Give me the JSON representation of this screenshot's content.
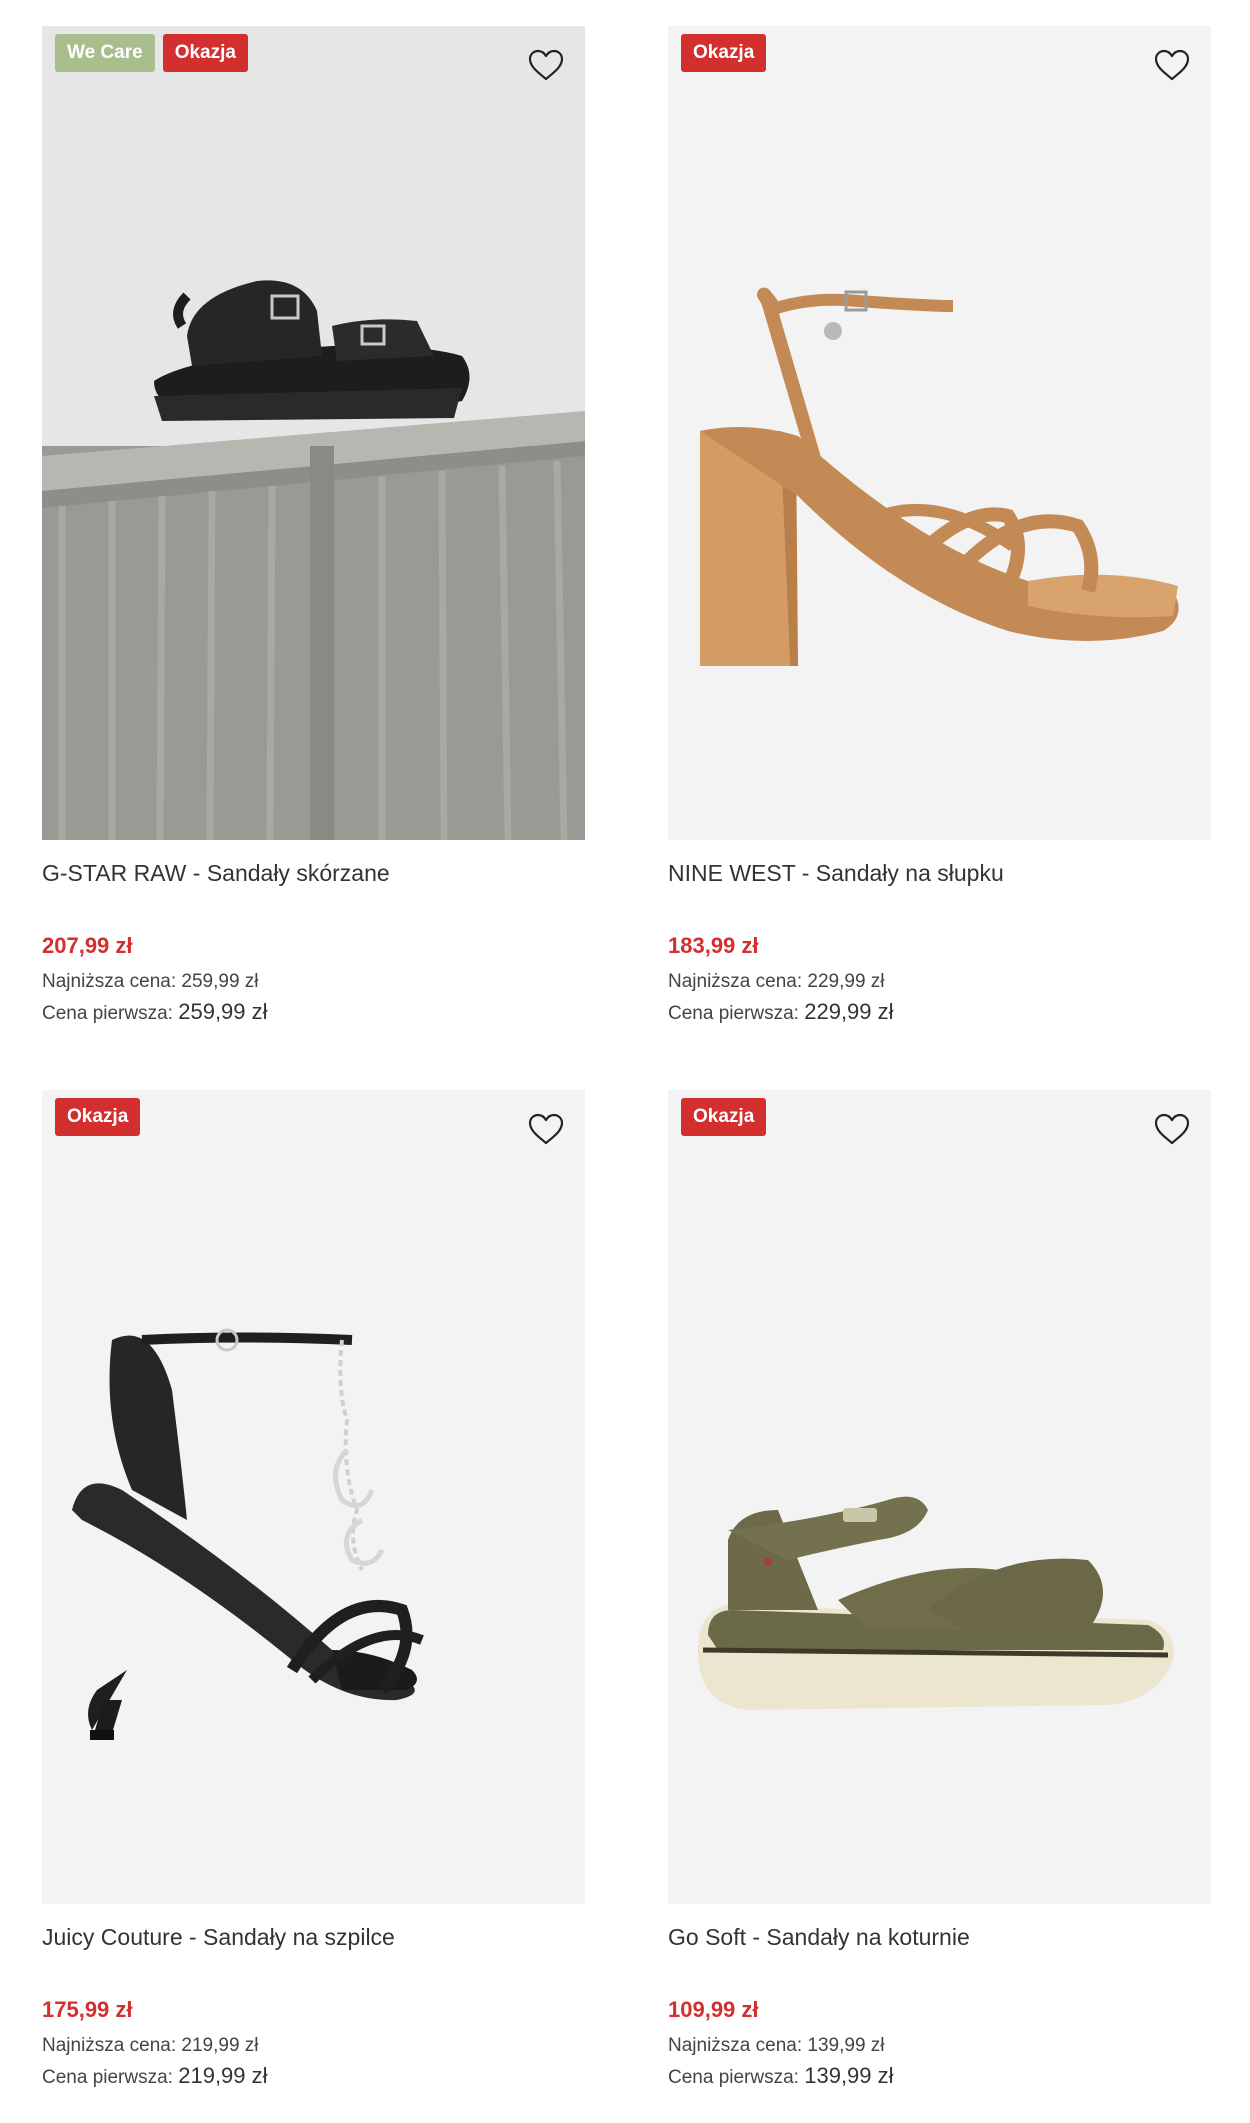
{
  "colors": {
    "sale_price": "#d32f2f",
    "badge_okazja": "#d32f2f",
    "badge_wecare": "#a8be8c",
    "photo_bg": "#f3f3f3"
  },
  "products": [
    {
      "title": "G-STAR RAW - Sandały skórzane",
      "price": "207,99 zł",
      "lowest_label": "Najniższa cena:",
      "lowest_value": "259,99 zł",
      "first_label": "Cena pierwsza:",
      "first_value": "259,99 zł",
      "badges": [
        "We Care",
        "Okazja"
      ],
      "image_icon": "black-chunky-sandal-on-railing"
    },
    {
      "title": "NINE WEST - Sandały na słupku",
      "price": "183,99 zł",
      "lowest_label": "Najniższa cena:",
      "lowest_value": "229,99 zł",
      "first_label": "Cena pierwsza:",
      "first_value": "229,99 zł",
      "badges": [
        "Okazja"
      ],
      "image_icon": "tan-block-heel-sandal"
    },
    {
      "title": "Juicy Couture - Sandały na szpilce",
      "price": "175,99 zł",
      "lowest_label": "Najniższa cena:",
      "lowest_value": "219,99 zł",
      "first_label": "Cena pierwsza:",
      "first_value": "219,99 zł",
      "badges": [
        "Okazja"
      ],
      "image_icon": "black-stiletto-sandal"
    },
    {
      "title": "Go Soft - Sandały na koturnie",
      "price": "109,99 zł",
      "lowest_label": "Najniższa cena:",
      "lowest_value": "139,99 zł",
      "first_label": "Cena pierwsza:",
      "first_value": "139,99 zł",
      "badges": [
        "Okazja"
      ],
      "image_icon": "olive-wedge-sandal"
    }
  ],
  "wishlist_icon": "heart-outline-icon"
}
